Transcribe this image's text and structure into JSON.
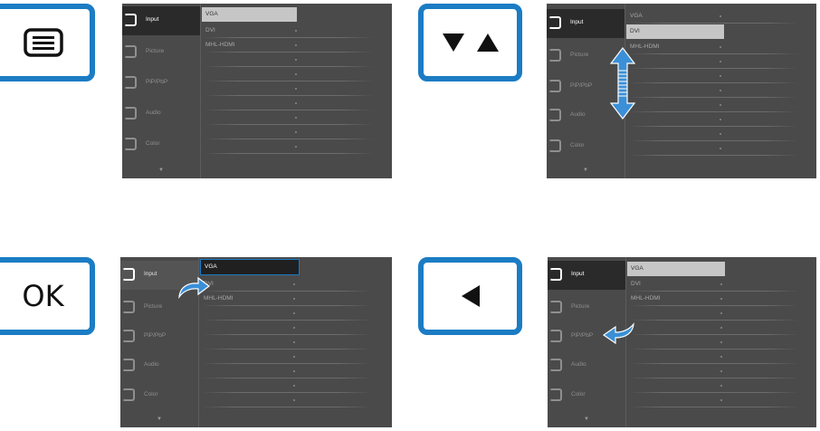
{
  "buttons": {
    "menu_icon": "menu-icon",
    "updown_icon": "up-down-icon",
    "ok_label": "OK",
    "left_icon": "left-arrow-icon"
  },
  "sidebar": {
    "items": [
      {
        "label": "Input",
        "icon": "input-icon"
      },
      {
        "label": "Picture",
        "icon": "picture-icon"
      },
      {
        "label": "PiP/PbP",
        "icon": "pip-icon"
      },
      {
        "label": "Audio",
        "icon": "audio-icon"
      },
      {
        "label": "Color",
        "icon": "color-icon"
      }
    ],
    "more_indicator": "▼"
  },
  "inputs": {
    "options": [
      "VGA",
      "DVI",
      "MHL-HDMI"
    ]
  },
  "colors": {
    "accent": "#1b7cc4",
    "panel": "#4a4a4a",
    "selected": "#2a2a2a"
  }
}
